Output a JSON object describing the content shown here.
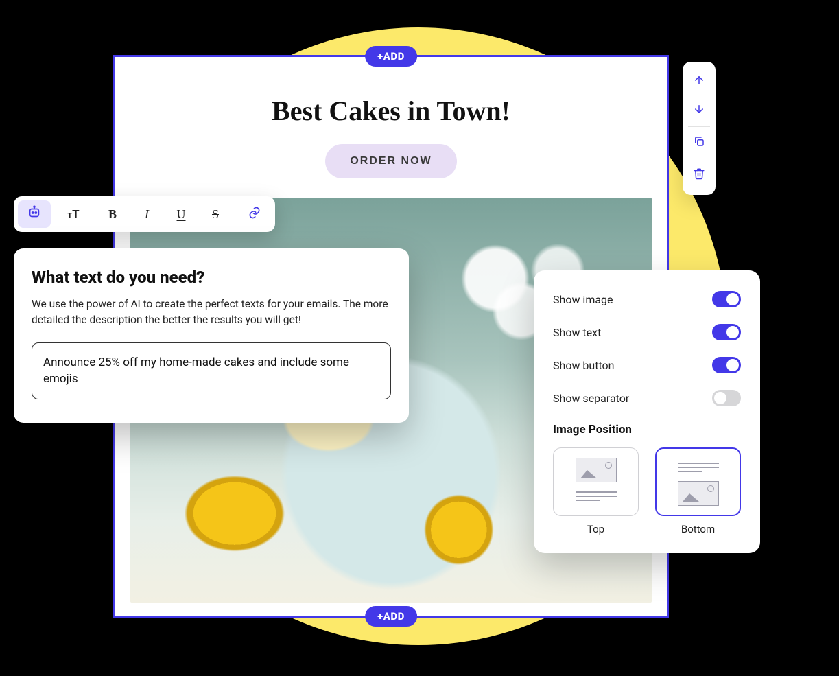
{
  "canvas": {
    "add_label": "+ADD",
    "hero_title": "Best Cakes in Town!",
    "order_button": "ORDER NOW"
  },
  "ai_panel": {
    "title": "What text do you need?",
    "description": "We use the power of AI to create the perfect texts for your emails. The more detailed the description the better the results you will get!",
    "prompt_value": "Announce 25% off my home-made cakes and include some emojis"
  },
  "settings": {
    "show_image": {
      "label": "Show image",
      "on": true
    },
    "show_text": {
      "label": "Show text",
      "on": true
    },
    "show_button": {
      "label": "Show button",
      "on": true
    },
    "show_separator": {
      "label": "Show separator",
      "on": false
    },
    "image_position_label": "Image Position",
    "position_top": "Top",
    "position_bottom": "Bottom",
    "selected_position": "bottom"
  },
  "icons": {
    "ai": "ai-icon",
    "text_size": "text-size-icon",
    "bold": "B",
    "italic": "I",
    "underline": "U",
    "strike": "S",
    "link": "link-icon",
    "up": "arrow-up-icon",
    "down": "arrow-down-icon",
    "copy": "copy-icon",
    "trash": "trash-icon"
  }
}
